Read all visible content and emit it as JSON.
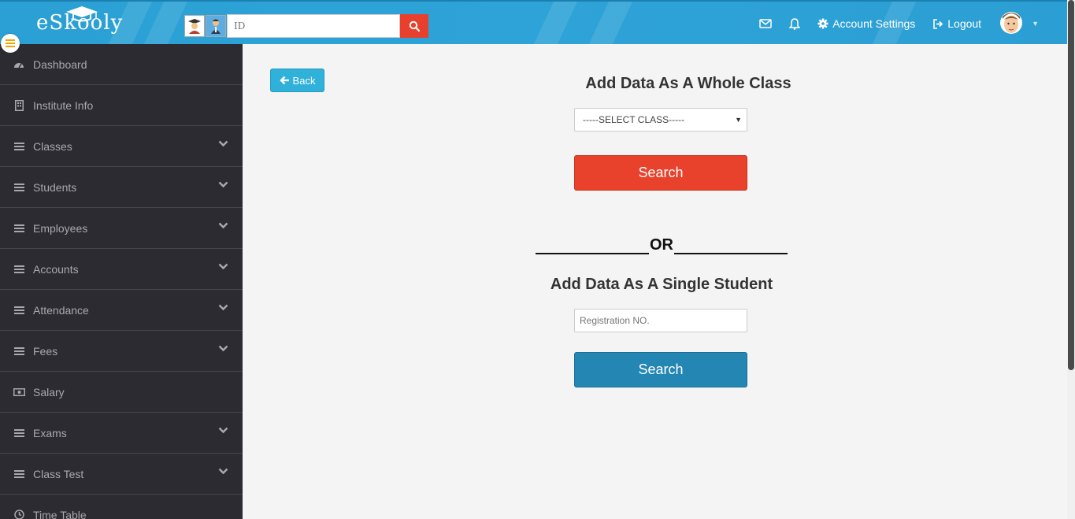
{
  "header": {
    "logo": "eSkooly",
    "id_placeholder": "ID",
    "nav": {
      "account_settings": "Account Settings",
      "logout": "Logout"
    }
  },
  "sidebar": {
    "items": [
      {
        "label": "Dashboard",
        "icon": "dashboard-icon",
        "has_children": false
      },
      {
        "label": "Institute Info",
        "icon": "building-icon",
        "has_children": false
      },
      {
        "label": "Classes",
        "icon": "list-icon",
        "has_children": true
      },
      {
        "label": "Students",
        "icon": "list-icon",
        "has_children": true
      },
      {
        "label": "Employees",
        "icon": "list-icon",
        "has_children": true
      },
      {
        "label": "Accounts",
        "icon": "list-icon",
        "has_children": true
      },
      {
        "label": "Attendance",
        "icon": "list-icon",
        "has_children": true
      },
      {
        "label": "Fees",
        "icon": "list-icon",
        "has_children": true
      },
      {
        "label": "Salary",
        "icon": "money-icon",
        "has_children": false
      },
      {
        "label": "Exams",
        "icon": "list-icon",
        "has_children": true
      },
      {
        "label": "Class Test",
        "icon": "list-icon",
        "has_children": true
      },
      {
        "label": "Time Table",
        "icon": "clock-icon",
        "has_children": false
      }
    ]
  },
  "main": {
    "back_label": "Back",
    "whole_class_heading": "Add Data As A Whole Class",
    "class_select_value": "-----SELECT CLASS-----",
    "search_label_1": "Search",
    "or_label": "OR",
    "single_student_heading": "Add Data As A Single Student",
    "registration_placeholder": "Registration NO.",
    "search_label_2": "Search"
  },
  "colors": {
    "header_bg": "#2ea3d7",
    "sidebar_bg": "#2b2b31",
    "search_red": "#e8412c",
    "search_blue": "#2486b3",
    "back_btn": "#2fb1da"
  }
}
